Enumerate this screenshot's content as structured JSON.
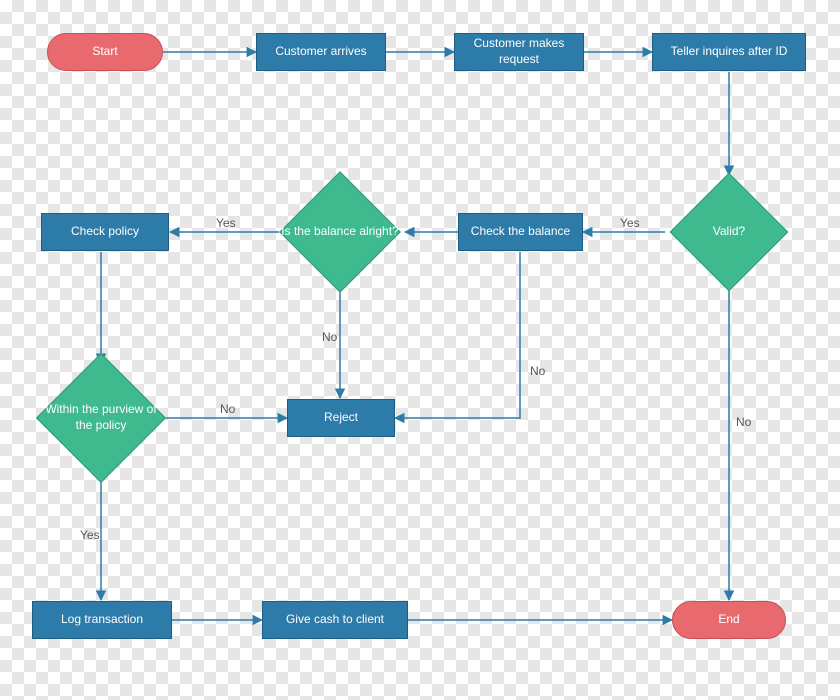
{
  "flowchart": {
    "nodes": {
      "start": {
        "label": "Start"
      },
      "customer_arrives": {
        "label": "Customer arrives"
      },
      "customer_request": {
        "label": "Customer makes request"
      },
      "teller_inquires": {
        "label": "Teller inquires after ID"
      },
      "valid": {
        "label": "Valid?"
      },
      "check_balance": {
        "label": "Check the balance"
      },
      "balance_ok": {
        "label": "Is the balance alright?"
      },
      "check_policy": {
        "label": "Check policy"
      },
      "within_policy": {
        "label": "Within the purview  of the policy"
      },
      "reject": {
        "label": "Reject"
      },
      "log_txn": {
        "label": "Log transaction"
      },
      "give_cash": {
        "label": "Give cash to client"
      },
      "end": {
        "label": "End"
      }
    },
    "edge_labels": {
      "yes": "Yes",
      "no": "No"
    },
    "edges": [
      {
        "from": "start",
        "to": "customer_arrives"
      },
      {
        "from": "customer_arrives",
        "to": "customer_request"
      },
      {
        "from": "customer_request",
        "to": "teller_inquires"
      },
      {
        "from": "teller_inquires",
        "to": "valid"
      },
      {
        "from": "valid",
        "to": "check_balance",
        "label": "Yes"
      },
      {
        "from": "valid",
        "to": "end",
        "label": "No"
      },
      {
        "from": "check_balance",
        "to": "balance_ok"
      },
      {
        "from": "check_balance",
        "to": "reject",
        "label": "No"
      },
      {
        "from": "balance_ok",
        "to": "check_policy",
        "label": "Yes"
      },
      {
        "from": "balance_ok",
        "to": "reject",
        "label": "No"
      },
      {
        "from": "check_policy",
        "to": "within_policy"
      },
      {
        "from": "within_policy",
        "to": "log_txn",
        "label": "Yes"
      },
      {
        "from": "within_policy",
        "to": "reject",
        "label": "No"
      },
      {
        "from": "log_txn",
        "to": "give_cash"
      },
      {
        "from": "give_cash",
        "to": "end"
      }
    ],
    "colors": {
      "process": "#2d7ba8",
      "decision": "#3fb98e",
      "terminator": "#e86a6f",
      "connector": "#2d7ba8"
    }
  }
}
